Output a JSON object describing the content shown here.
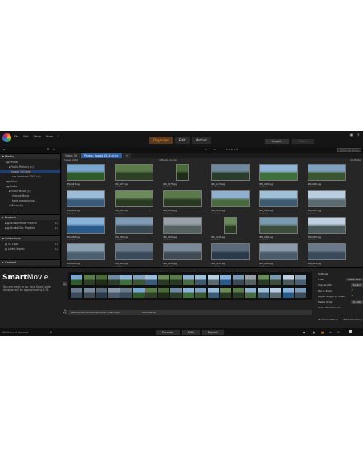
{
  "menu": [
    "File",
    "Edit",
    "Setup",
    "Share"
  ],
  "nav_tabs": [
    "Organize",
    "Edit",
    "Author"
  ],
  "import_buttons": {
    "import": "Import",
    "share": "Share"
  },
  "library_tabs": [
    "Video: 50",
    "Photos: hawaii 2014 (d:)"
  ],
  "grid": {
    "left_title": "hawaii 2014",
    "center_title": "4 Media sources",
    "right_title": "All Media"
  },
  "search": {
    "placeholder": "Search the Library"
  },
  "sidebar": {
    "media_header": "Media",
    "items": [
      {
        "label": "Photos",
        "indent": 1
      },
      {
        "label": "Public Pictures (c:)",
        "indent": 2
      },
      {
        "label": "hawaii 2014 (d:)",
        "indent": 3,
        "selected": true
      },
      {
        "label": "san francisco 2007 (c:)",
        "indent": 3
      },
      {
        "label": "Video",
        "indent": 1
      },
      {
        "label": "Audio",
        "indent": 1
      },
      {
        "label": "Public Music (c:)",
        "indent": 2
      },
      {
        "label": "Sample Music",
        "indent": 3
      },
      {
        "label": "triple scoop music",
        "indent": 3
      },
      {
        "label": "Music (d:)",
        "indent": 2
      }
    ],
    "projects_header": "Projects",
    "projects": [
      {
        "label": "Studio Movie Projects",
        "count": "(1)"
      },
      {
        "label": "Studio Disc Projects",
        "count": "(1)"
      }
    ],
    "collections_header": "Collections",
    "collections": [
      {
        "label": "SC clips",
        "count": "(1)"
      },
      {
        "label": "Latest Import",
        "count": "(1)"
      }
    ],
    "content_header": "Content"
  },
  "thumbnails": [
    {
      "name": "IMG_0476.jpg",
      "colors": [
        "#7aa7d0",
        "#2f5b2a"
      ],
      "portrait": false
    },
    {
      "name": "IMG_0477.jpg",
      "colors": [
        "#5b7c4a",
        "#2d3f25"
      ],
      "portrait": false
    },
    {
      "name": "IMG_0478.jpg",
      "colors": [
        "#4a6a3a",
        "#1e2c18"
      ],
      "portrait": true
    },
    {
      "name": "IMG_0479.jpg",
      "colors": [
        "#6f8aa0",
        "#2a3c2c"
      ],
      "portrait": false
    },
    {
      "name": "IMG_0480.jpg",
      "colors": [
        "#8fb3d6",
        "#3f6f3a"
      ],
      "portrait": false
    },
    {
      "name": "IMG_0481.jpg",
      "colors": [
        "#7fa1bf",
        "#3a5530"
      ],
      "portrait": false
    },
    {
      "name": "IMG_0482.jpg",
      "colors": [
        "#9bbcd8",
        "#3a5a7a"
      ],
      "portrait": false
    },
    {
      "name": "IMG_0483.jpg",
      "colors": [
        "#6b8b5b",
        "#2a3a22"
      ],
      "portrait": false
    },
    {
      "name": "IMG_0484.jpg",
      "colors": [
        "#5a7a4a",
        "#283822"
      ],
      "portrait": false
    },
    {
      "name": "IMG_0485.jpg",
      "colors": [
        "#8fb0cf",
        "#4a6a40"
      ],
      "portrait": false
    },
    {
      "name": "IMG_0486.jpg",
      "colors": [
        "#a0c0d8",
        "#3d5a6e"
      ],
      "portrait": false
    },
    {
      "name": "IMG_0487.jpg",
      "colors": [
        "#b8cde0",
        "#5a6a70"
      ],
      "portrait": false
    },
    {
      "name": "IMG_0488.jpg",
      "colors": [
        "#8ab2d8",
        "#2a5a8a"
      ],
      "portrait": false
    },
    {
      "name": "IMG_0489.jpg",
      "colors": [
        "#7f9ab5",
        "#3a4a55"
      ],
      "portrait": false
    },
    {
      "name": "IMG_0490.jpg",
      "colors": [
        "#9aa0a8",
        "#556060"
      ],
      "portrait": false
    },
    {
      "name": "IMG_0491.jpg",
      "colors": [
        "#6a8a5a",
        "#2a3a22"
      ],
      "portrait": true
    },
    {
      "name": "IMG_0492.jpg",
      "colors": [
        "#7a9ab0",
        "#3a4e3a"
      ],
      "portrait": false
    },
    {
      "name": "IMG_0493.jpg",
      "colors": [
        "#c0d0e0",
        "#4a5a5a"
      ],
      "portrait": false
    },
    {
      "name": "IMG_0494.jpg",
      "colors": [
        "#8aa0b0",
        "#4a6070"
      ],
      "portrait": false
    },
    {
      "name": "IMG_0495.jpg",
      "colors": [
        "#6a7a8a",
        "#3a4a5a"
      ],
      "portrait": false
    },
    {
      "name": "IMG_0496.jpg",
      "colors": [
        "#7a8a9a",
        "#404a55"
      ],
      "portrait": false
    },
    {
      "name": "IMG_0497.jpg",
      "colors": [
        "#5a6a7a",
        "#2a3a4a"
      ],
      "portrait": false
    },
    {
      "name": "IMG_0498.jpg",
      "colors": [
        "#8a9aaa",
        "#4a5a6a"
      ],
      "portrait": false
    },
    {
      "name": "IMG_0499.jpg",
      "colors": [
        "#6a7a8a",
        "#3a4a5a"
      ],
      "portrait": false
    }
  ],
  "smartmovie": {
    "title_main": "Smart",
    "title_sub": "Movie",
    "description": "You are ready to go. Your Smart slide duration will be approximately 2:51",
    "audio_file": "Misirlou (the official Pulp Fiction music).mp3",
    "audio_duration": "00:01:21.00"
  },
  "settings": {
    "header": "Settings",
    "rows": [
      {
        "label": "Title",
        "value": "Hawaii 2014",
        "check": false
      },
      {
        "label": "Clip lengths",
        "value": "Medium",
        "check": false
      },
      {
        "label": "Pan & Zoom",
        "value": "",
        "check": true
      },
      {
        "label": "Adjust length to music",
        "value": "",
        "check": true
      },
      {
        "label": "Media Order",
        "value": "By date",
        "check": false
      },
      {
        "label": "Video Track Volume",
        "value": "",
        "check": false
      }
    ],
    "video_settings_label": "Video settings",
    "reset_label": "Reset settings"
  },
  "status": {
    "text": "60 items, 0 selected"
  },
  "bottom_buttons": [
    "Preview",
    "Edit",
    "Export"
  ],
  "accent_color": "#ff9a3c",
  "selection_color": "#2d5fa8"
}
